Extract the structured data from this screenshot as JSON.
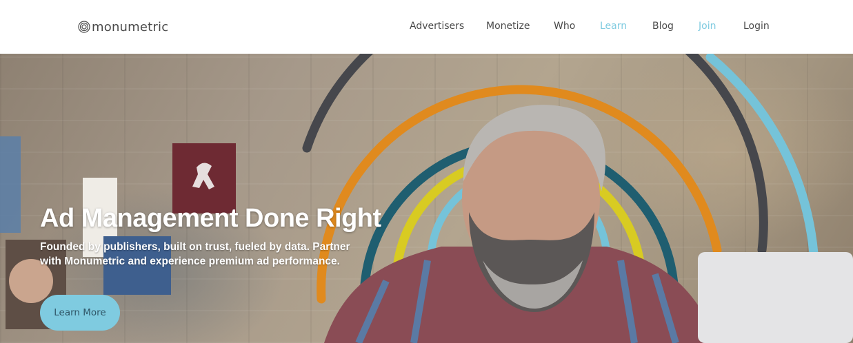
{
  "header": {
    "logo_text": "monumetric",
    "logo_icon": "concentric-circles-icon",
    "nav": [
      {
        "label": "Advertisers",
        "accent": false
      },
      {
        "label": "Monetize",
        "accent": false
      },
      {
        "label": "Who",
        "accent": false
      },
      {
        "label": "Learn",
        "accent": true
      },
      {
        "label": "Blog",
        "accent": false
      },
      {
        "label": "Join",
        "accent": true
      },
      {
        "label": "Login",
        "accent": false
      }
    ]
  },
  "hero": {
    "title": "Ad Management Done Right",
    "subtitle": "Founded by publishers, built on trust, fueled by data. Partner with Monumetric and experience premium ad performance.",
    "cta_label": "Learn More",
    "ring_colors": [
      "#46474c",
      "#75c3d9",
      "#e08a1e",
      "#1f5e70",
      "#d8cb22"
    ]
  },
  "colors": {
    "accent": "#7fcbe0",
    "text": "#4a4a4a"
  }
}
